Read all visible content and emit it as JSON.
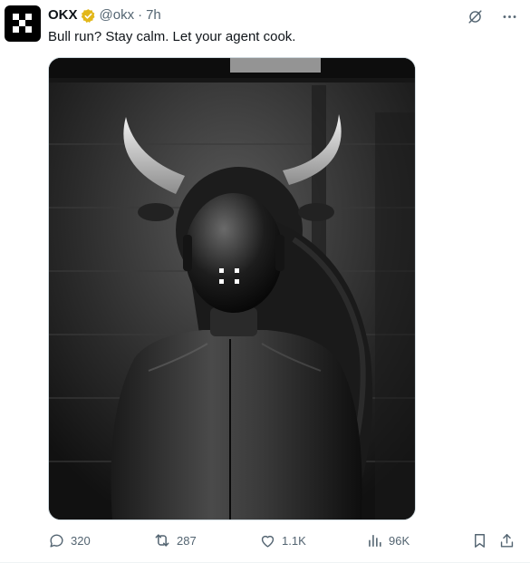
{
  "author": {
    "name": "OKX",
    "handle": "@okx",
    "separator": "·",
    "time": "7h"
  },
  "tweet": {
    "text": "Bull run? Stay calm. Let your agent cook."
  },
  "actions": {
    "reply_count": "320",
    "retweet_count": "287",
    "like_count": "1.1K",
    "view_count": "96K"
  },
  "icons": {
    "verified": "verified-badge-icon",
    "grok": "grok-icon",
    "more": "more-icon",
    "reply": "reply-icon",
    "retweet": "retweet-icon",
    "like": "heart-icon",
    "views": "views-icon",
    "bookmark": "bookmark-icon",
    "share": "share-icon"
  },
  "colors": {
    "verified_gold": "#e2b719",
    "muted": "#536471",
    "text": "#0f1419"
  }
}
